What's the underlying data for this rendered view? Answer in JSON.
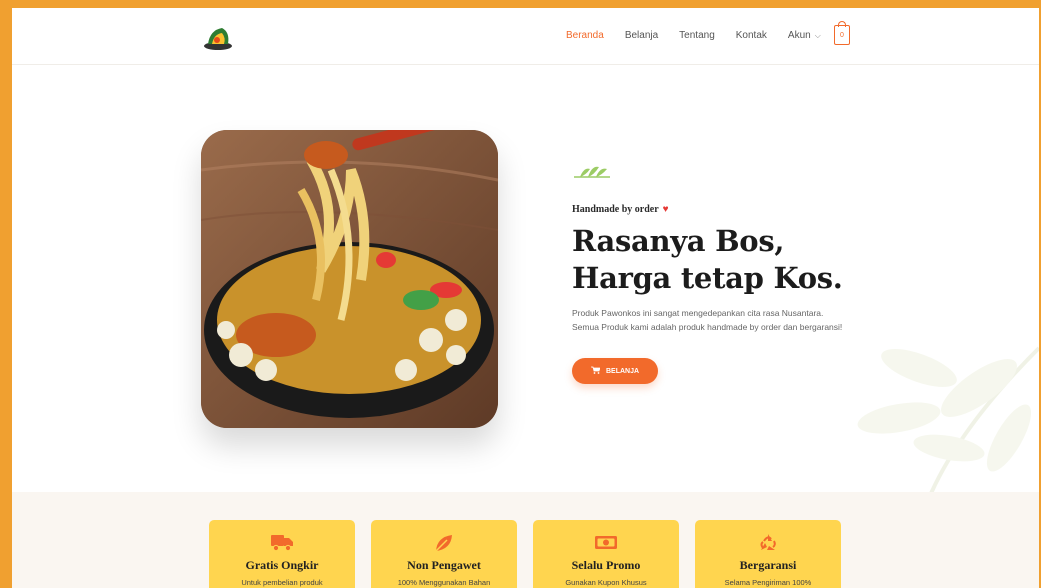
{
  "colors": {
    "accent": "#f26a2b",
    "feature_card": "#ffd54f",
    "frame": "#f0a030"
  },
  "header": {
    "logo_icon": "brand-logo",
    "nav": [
      {
        "label": "Beranda",
        "active": true
      },
      {
        "label": "Belanja"
      },
      {
        "label": "Tentang"
      },
      {
        "label": "Kontak"
      },
      {
        "label": "Akun",
        "dropdown": true
      }
    ],
    "cart_count": "0"
  },
  "hero": {
    "decoration_icon": "leaf-sprig-icon",
    "tagline": "Handmade by order",
    "headline_line1": "Rasanya Bos,",
    "headline_line2": "Harga tetap Kos.",
    "description": "Produk Pawonkos ini sangat mengedepankan cita rasa Nusantara. Semua Produk kami adalah produk handmade by order dan bergaransi!",
    "cta_label": "BELANJA",
    "image_subject": "noodle-bowl-photo"
  },
  "features": [
    {
      "icon": "truck-icon",
      "title": "Gratis Ongkir",
      "subtitle": "Untuk pembelian produk"
    },
    {
      "icon": "leaf-icon",
      "title": "Non Pengawet",
      "subtitle": "100% Menggunakan Bahan"
    },
    {
      "icon": "money-icon",
      "title": "Selalu Promo",
      "subtitle": "Gunakan Kupon Khusus"
    },
    {
      "icon": "recycle-icon",
      "title": "Bergaransi",
      "subtitle": "Selama Pengiriman 100%"
    }
  ]
}
